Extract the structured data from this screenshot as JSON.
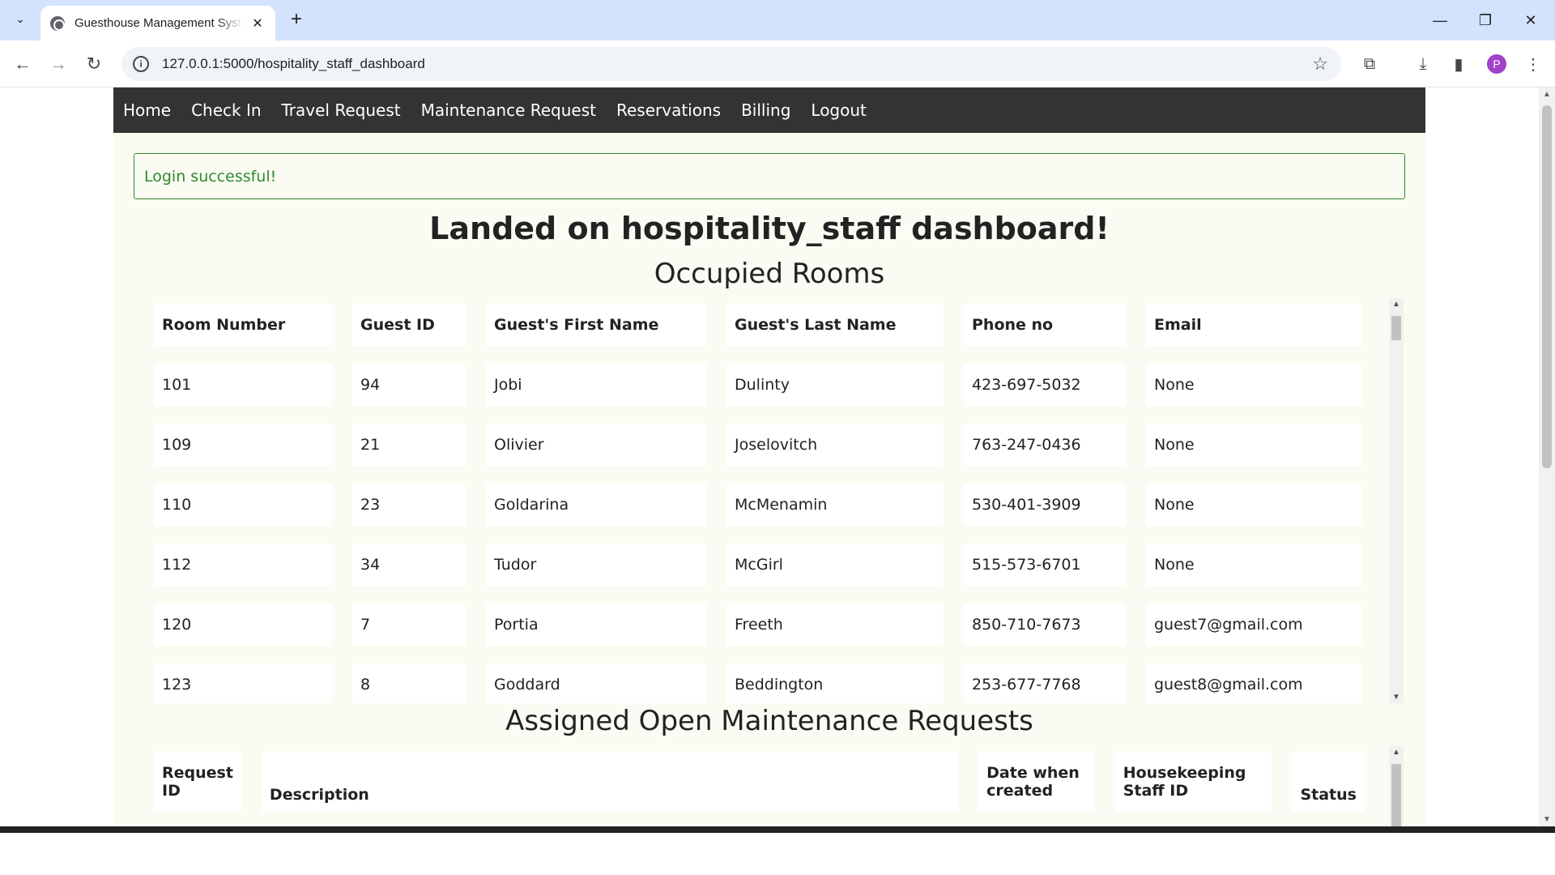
{
  "browser": {
    "tab_title": "Guesthouse Management System",
    "url": "127.0.0.1:5000/hospitality_staff_dashboard",
    "profile_initial": "P"
  },
  "nav": {
    "items": [
      "Home",
      "Check In",
      "Travel Request",
      "Maintenance Request",
      "Reservations",
      "Billing",
      "Logout"
    ]
  },
  "alert": {
    "text": "Login successful!"
  },
  "headings": {
    "main": "Landed on hospitality_staff dashboard!",
    "occupied": "Occupied Rooms",
    "maintenance": "Assigned Open Maintenance Requests"
  },
  "occupied_table": {
    "headers": [
      "Room Number",
      "Guest ID",
      "Guest's First Name",
      "Guest's Last Name",
      "Phone no",
      "Email"
    ],
    "rows": [
      [
        "101",
        "94",
        "Jobi",
        "Dulinty",
        "423-697-5032",
        "None"
      ],
      [
        "109",
        "21",
        "Olivier",
        "Joselovitch",
        "763-247-0436",
        "None"
      ],
      [
        "110",
        "23",
        "Goldarina",
        "McMenamin",
        "530-401-3909",
        "None"
      ],
      [
        "112",
        "34",
        "Tudor",
        "McGirl",
        "515-573-6701",
        "None"
      ],
      [
        "120",
        "7",
        "Portia",
        "Freeth",
        "850-710-7673",
        "guest7@gmail.com"
      ],
      [
        "123",
        "8",
        "Goddard",
        "Beddington",
        "253-677-7768",
        "guest8@gmail.com"
      ]
    ]
  },
  "maintenance_table": {
    "headers": [
      "Request ID",
      "Description",
      "Date when created",
      "Housekeeping Staff ID",
      "Status"
    ]
  },
  "icons": {
    "tab_search": "chevron-down-icon",
    "favicon": "globe-icon",
    "back": "back-arrow-icon",
    "forward": "forward-arrow-icon",
    "reload": "reload-icon",
    "info": "info-icon",
    "star": "star-icon",
    "extensions": "puzzle-icon",
    "download": "download-icon",
    "sidepanel": "side-panel-icon",
    "menu": "kebab-menu-icon"
  },
  "colors": {
    "nav_bg": "#333333",
    "page_bg": "#fbfbf3",
    "alert_green": "#2e8b2e",
    "chrome_tabbar": "#d3e3fd"
  }
}
